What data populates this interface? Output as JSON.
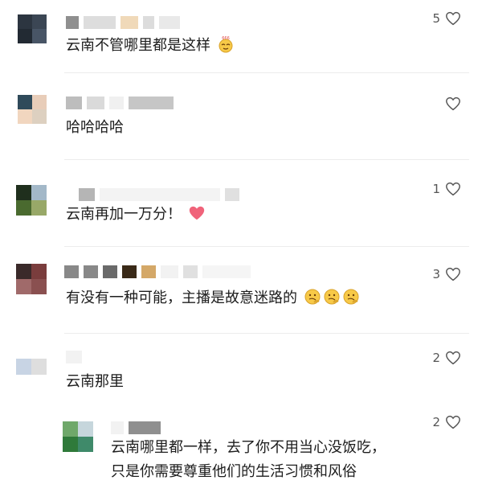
{
  "comments": [
    {
      "text": "云南不管哪里都是这样",
      "likes": "5",
      "emoji_icons": [
        "smug-face-666-icon"
      ]
    },
    {
      "text": "哈哈哈哈",
      "likes": ""
    },
    {
      "text": "云南再加一万分！",
      "likes": "1",
      "emoji_icons": [
        "pink-heart-icon"
      ]
    },
    {
      "text": "有没有一种可能，主播是故意迷路的",
      "likes": "3",
      "emoji_icons": [
        "thinking-face-icon",
        "thinking-face-icon",
        "thinking-face-icon"
      ]
    },
    {
      "text": "云南那里",
      "likes": "2"
    }
  ],
  "reply": {
    "lines": [
      "云南哪里都一样，去了你不用当心没饭吃，",
      "只是你需要尊重他们的生活习惯和风俗"
    ],
    "likes": "2"
  },
  "colors": {
    "heart_outline": "#555555",
    "pink_heart": "#f0637a",
    "emoji_yellow": "#f7c948"
  }
}
